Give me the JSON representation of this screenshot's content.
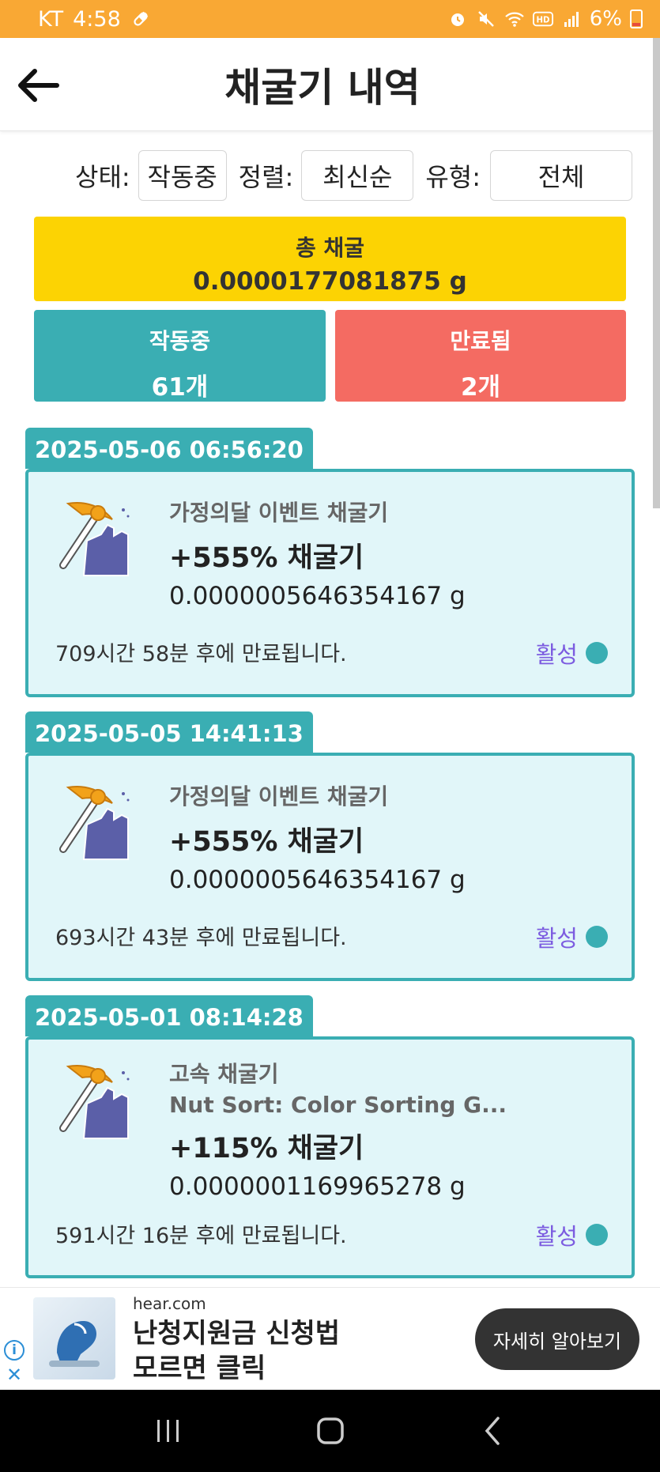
{
  "status_bar": {
    "carrier": "KT",
    "time": "4:58",
    "battery": "6%"
  },
  "header": {
    "title": "채굴기 내역"
  },
  "filters": {
    "status_label": "상태:",
    "status_value": "작동중",
    "sort_label": "정렬:",
    "sort_value": "최신순",
    "type_label": "유형:",
    "type_value": "전체"
  },
  "total": {
    "label": "총 채굴",
    "value": "0.0000177081875 g"
  },
  "stats": {
    "active_label": "작동중",
    "active_count": "61개",
    "expired_label": "만료됨",
    "expired_count": "2개"
  },
  "miners": [
    {
      "date": "2025-05-06 06:56:20",
      "event": "가정의달 이벤트 채굴기",
      "rate": "+555% 채굴기",
      "amount": "0.0000005646354167 g",
      "expire": "709시간 58분 후에 만료됩니다.",
      "status": "활성"
    },
    {
      "date": "2025-05-05 14:41:13",
      "event": "가정의달 이벤트 채굴기",
      "rate": "+555% 채굴기",
      "amount": "0.0000005646354167 g",
      "expire": "693시간 43분 후에 만료됩니다.",
      "status": "활성"
    },
    {
      "date": "2025-05-01 08:14:28",
      "event": "고속 채굴기",
      "subtitle": "Nut Sort: Color Sorting G...",
      "rate": "+115% 채굴기",
      "amount": "0.0000001169965278 g",
      "expire": "591시간 16분 후에 만료됩니다.",
      "status": "활성"
    }
  ],
  "ad": {
    "domain": "hear.com",
    "title_line1": "난청지원금 신청법",
    "title_line2": "모르면 클릭",
    "cta": "자세히 알아보기"
  },
  "colors": {
    "status_bar": "#f9a834",
    "total_bg": "#fcd303",
    "teal": "#3aaeb3",
    "expired": "#f46b62",
    "card_bg": "#e1f6f9",
    "status_text": "#7c5ce0"
  }
}
